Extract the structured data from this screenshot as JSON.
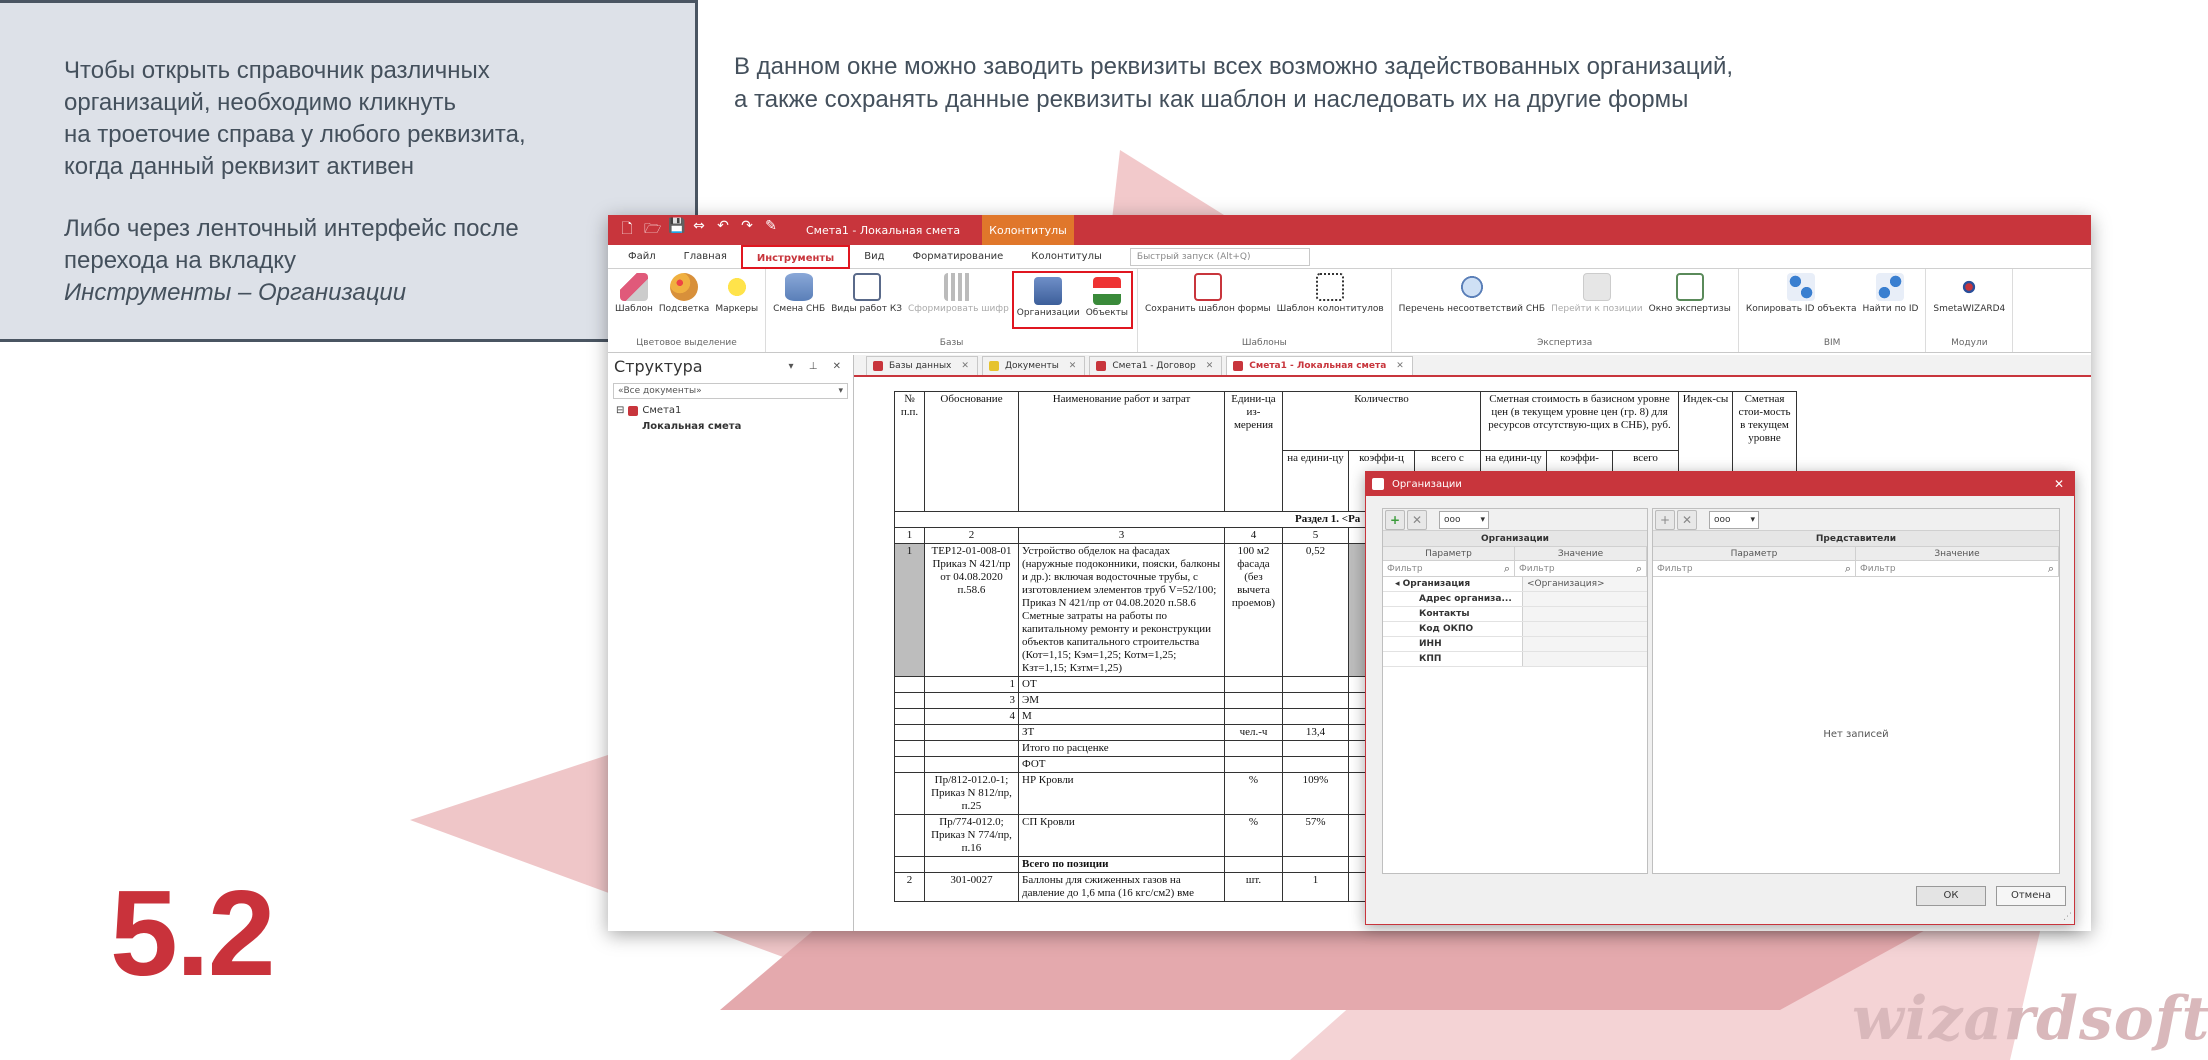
{
  "slide": {
    "callout_lines": [
      "Чтобы открыть справочник различных",
      "организаций, необходимо кликнуть",
      "на троеточие справа у любого реквизита,",
      "когда данный реквизит активен"
    ],
    "callout_lines2": [
      "Либо через ленточный интерфейс после",
      "перехода на вкладку"
    ],
    "callout_italic": "Инструменты – Организации",
    "heading_line1": "В данном окне можно заводить реквизиты всех возможно задействованных организаций,",
    "heading_line2": "а также сохранять данные реквизиты как шаблон и наследовать их на другие формы",
    "number": "5.2",
    "logo": "wizardsoft",
    "colors": {
      "accent": "#c9323b",
      "callout_bg": "#dde1e8",
      "shape": "#e9b3b6"
    }
  },
  "app": {
    "title": "Смета1 - Локальная смета",
    "context_tab": "Колонтитулы",
    "tabs": [
      "Файл",
      "Главная",
      "Инструменты",
      "Вид",
      "Форматирование",
      "Колонтитулы"
    ],
    "active_tab_index": 2,
    "search_placeholder": "Быстрый запуск (Alt+Q)",
    "ribbon": [
      {
        "name": "Цветовое выделение",
        "buttons": [
          {
            "label": "Шаблон",
            "icon": "eraser-icon"
          },
          {
            "label": "Подсветка",
            "icon": "palette-icon"
          },
          {
            "label": "Маркеры",
            "icon": "bulb-icon"
          }
        ]
      },
      {
        "name": "Базы",
        "buttons": [
          {
            "label": "Смена СНБ",
            "icon": "database-icon"
          },
          {
            "label": "Виды работ КЗ",
            "icon": "book-icon"
          },
          {
            "label": "Сформировать шифр",
            "icon": "qr-icon",
            "disabled": true
          },
          {
            "label": "Организации",
            "icon": "building-icon"
          },
          {
            "label": "Объекты",
            "icon": "flag-icon"
          }
        ]
      },
      {
        "name": "Шаблоны",
        "buttons": [
          {
            "label": "Сохранить шаблон формы",
            "icon": "form-icon"
          },
          {
            "label": "Шаблон колонтитулов",
            "icon": "dots-icon"
          }
        ]
      },
      {
        "name": "Экспертиза",
        "buttons": [
          {
            "label": "Перечень несоответствий СНБ",
            "icon": "magnifier-icon"
          },
          {
            "label": "Перейти к позиции",
            "icon": "goto-icon",
            "disabled": true
          },
          {
            "label": "Окно экспертизы",
            "icon": "expert-icon"
          }
        ]
      },
      {
        "name": "BIM",
        "buttons": [
          {
            "label": "Копировать ID объекта",
            "icon": "copy-id-icon"
          },
          {
            "label": "Найти по ID",
            "icon": "find-id-icon"
          }
        ]
      },
      {
        "name": "Модули",
        "buttons": [
          {
            "label": "SmetaWIZARD4",
            "icon": "atom-icon"
          }
        ]
      }
    ],
    "structure_pane": {
      "title": "Структура",
      "filter": "«Все документы»",
      "tree": [
        "Смета1",
        "Локальная смета"
      ]
    },
    "doc_tabs": [
      {
        "label": "Базы данных",
        "color": "#c8353c"
      },
      {
        "label": "Документы",
        "color": "#e6c32e"
      },
      {
        "label": "Смета1 - Договор",
        "color": "#c8353c"
      },
      {
        "label": "Смета1 - Локальная смета",
        "color": "#c8353c",
        "active": true
      }
    ],
    "estimate": {
      "headers": {
        "num": "№ п.п.",
        "basis": "Обоснование",
        "name": "Наименование работ и затрат",
        "unit": "Едини-ца из-мерения",
        "qty": "Количество",
        "qty_per_unit": "на едини-цу",
        "qty_coef": "коэффи-ц",
        "qty_total": "всего с",
        "cost": "Сметная стоимость в базисном уровне цен (в текущем уровне цен (гр. 8) для ресурсов отсутствую-щих в СНБ), руб.",
        "cost_per_unit": "на едини-цу",
        "cost_coef": "коэффи-",
        "cost_total": "всего",
        "index": "Индек-сы",
        "current": "Сметная стои-мость в текущем уровне"
      },
      "section": "Раздел 1. <Ра",
      "col_numbers": [
        "1",
        "2",
        "3",
        "4",
        "5"
      ],
      "rows": [
        {
          "num": "1",
          "basis": "ТЕР12-01-008-01 Приказ N 421/пр от 04.08.2020 п.58.6",
          "name": "Устройство обделок на фасадах (наружные подоконники, пояски, балконы и др.): включая водосточные трубы, с изготовлением элементов труб V=52/100; Приказ N 421/пр от 04.08.2020 п.58.6 Сметные затраты на работы по капитальному ремонту и реконструкции объектов капитального строительства (Кот=1,15; Кэм=1,25; Котм=1,25; Кзт=1,15; Кзтм=1,25)",
          "unit": "100 м2 фасада (без вычета проемов)",
          "qty": "0,52"
        },
        {
          "basis": "1",
          "name": "ОТ"
        },
        {
          "basis": "3",
          "name": "ЭМ"
        },
        {
          "basis": "4",
          "name": "М"
        },
        {
          "name": "ЗТ",
          "unit": "чел.-ч",
          "qty": "13,4"
        },
        {
          "name": "Итого по расценке"
        },
        {
          "name": "ФОТ"
        },
        {
          "basis": "Пр/812-012.0-1; Приказ N 812/пр, п.25",
          "name": "НР Кровли",
          "unit": "%",
          "qty": "109%"
        },
        {
          "basis": "Пр/774-012.0; Приказ N 774/пр, п.16",
          "name": "СП Кровли",
          "unit": "%",
          "qty": "57%"
        },
        {
          "name": "Всего по позиции",
          "bold": true
        },
        {
          "num": "2",
          "basis": "301-0027",
          "name": "Баллоны для сжиженных газов на давление до 1,6 мпа (16 кгс/см2) вме",
          "unit": "шт.",
          "qty": "1"
        }
      ]
    },
    "dialog": {
      "title": "Организации",
      "left_header": "Организации",
      "right_header": "Представители",
      "col_param": "Параметр",
      "col_value": "Значение",
      "filter": "Фильтр",
      "selector": "ооо",
      "root": {
        "key": "Организация",
        "value": "<Организация>"
      },
      "rows": [
        "Адрес организа...",
        "Контакты",
        "Код ОКПО",
        "ИНН",
        "КПП"
      ],
      "empty": "Нет записей",
      "ok": "ОК",
      "cancel": "Отмена"
    }
  }
}
